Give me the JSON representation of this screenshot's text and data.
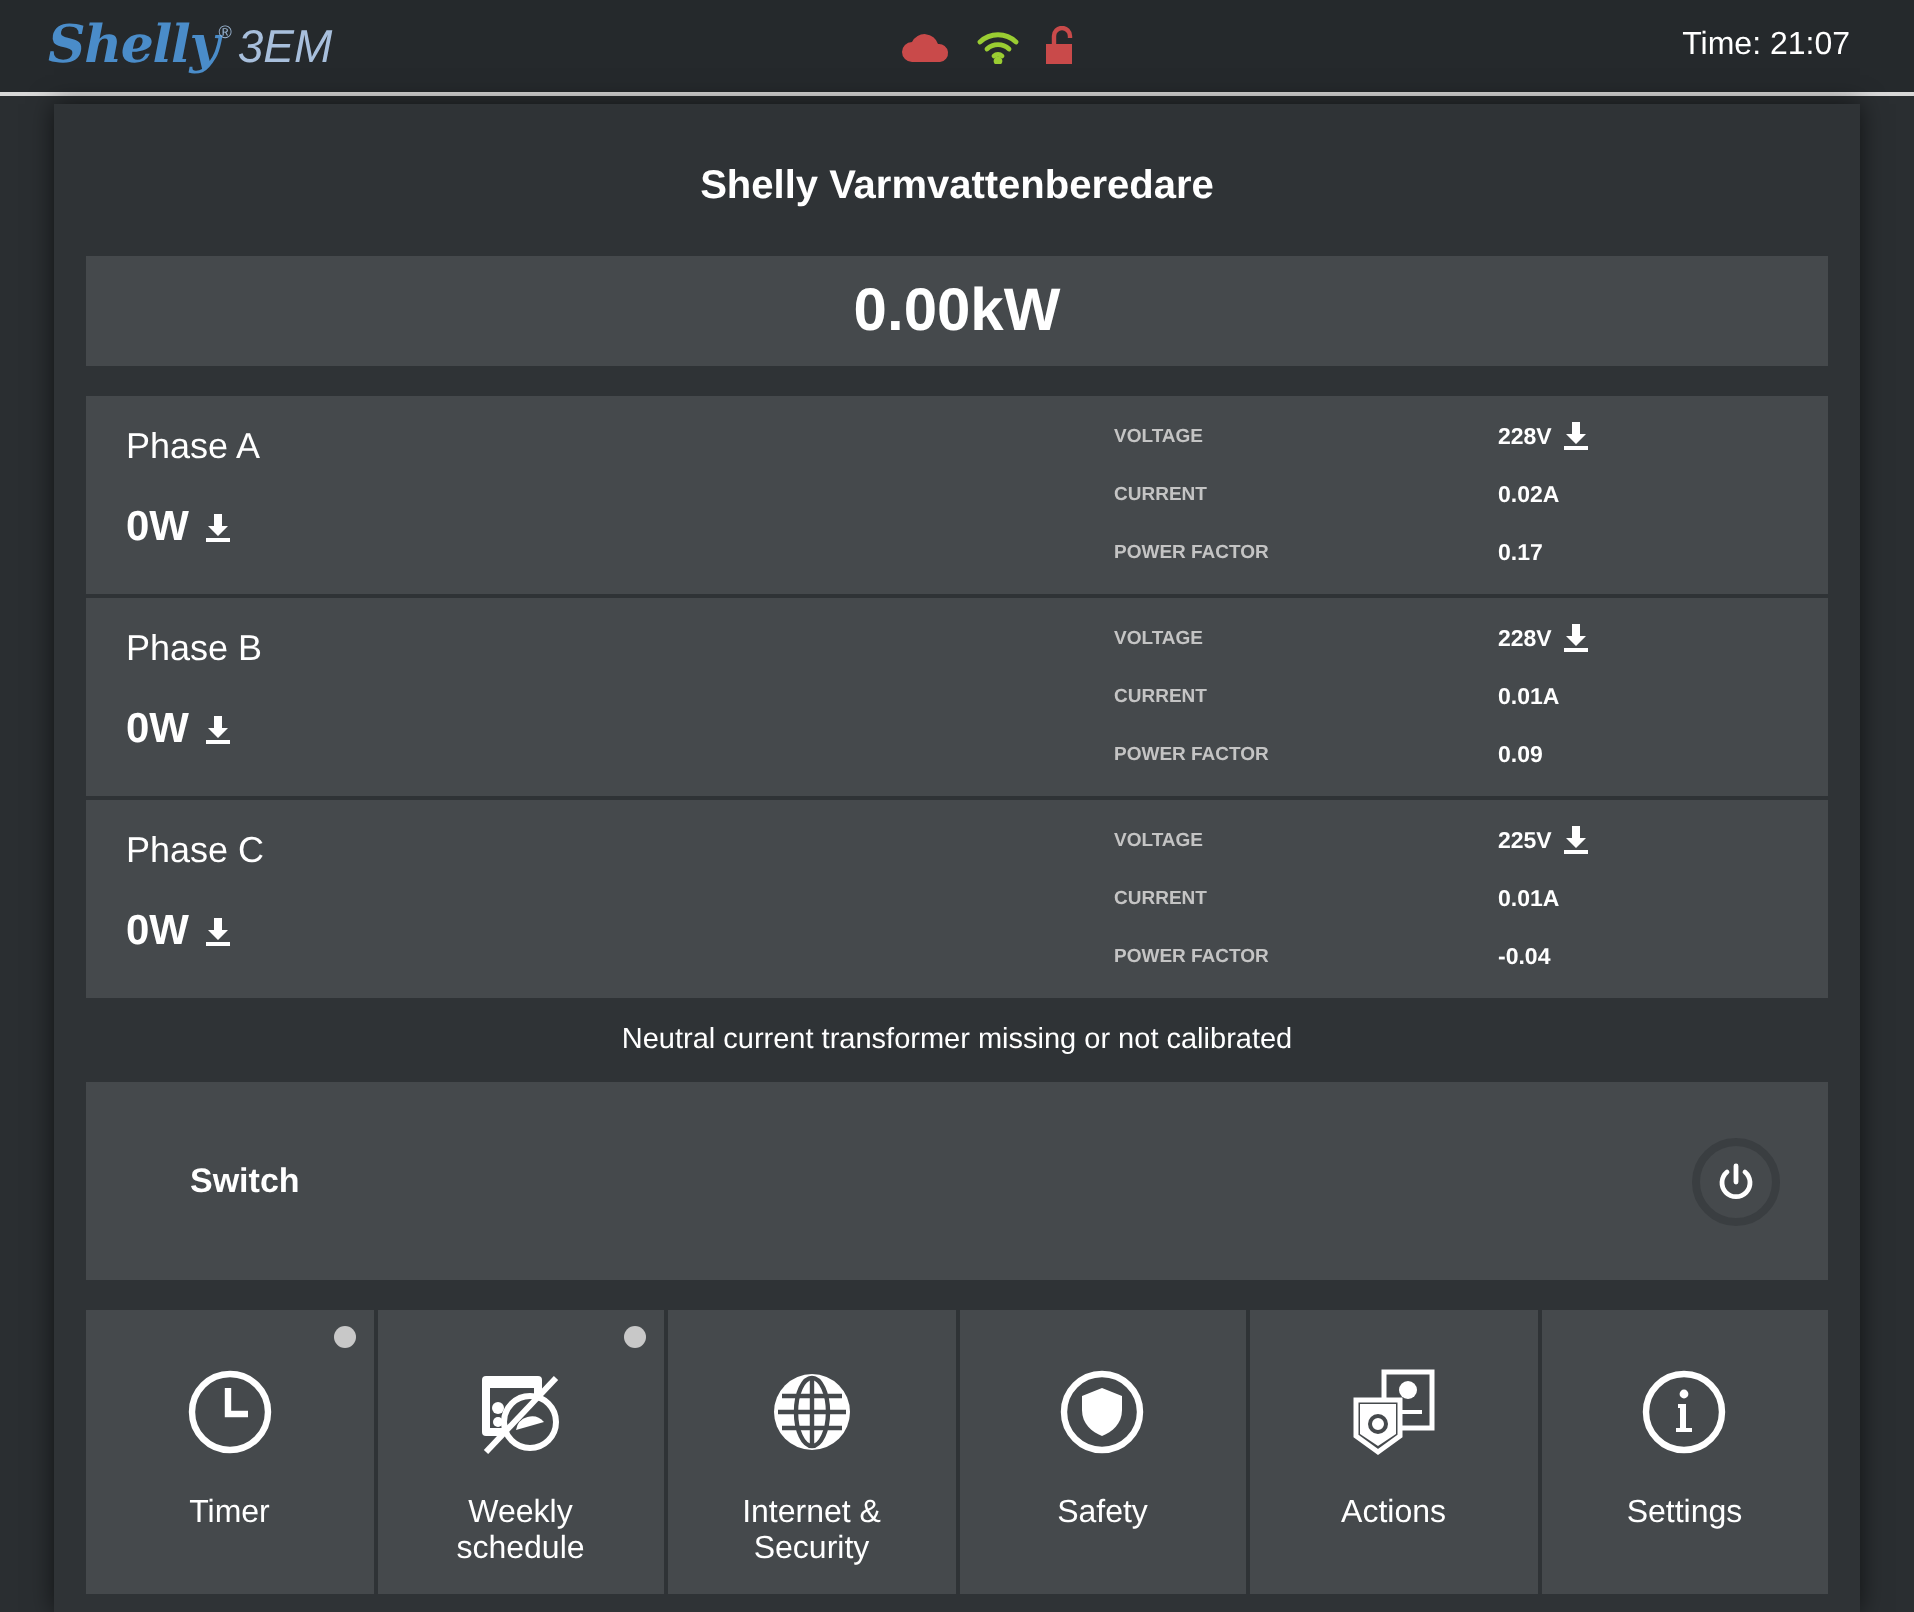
{
  "header": {
    "brand": "Shelly",
    "registered": "®",
    "model": "3EM",
    "status_icons": [
      {
        "kind": "cloud",
        "color": "#c94a4a"
      },
      {
        "kind": "wifi",
        "color": "#9acd32"
      },
      {
        "kind": "lock",
        "color": "#c94a4a"
      }
    ],
    "time": "Time: 21:07"
  },
  "device": {
    "title": "Shelly Varmvattenberedare",
    "total_power": "0.00kW"
  },
  "phases": [
    {
      "name": "Phase A",
      "power": "0W",
      "power_arrow": true,
      "readings": [
        {
          "label": "VOLTAGE",
          "value": "228V",
          "arrow": true
        },
        {
          "label": "CURRENT",
          "value": "0.02A",
          "arrow": false
        },
        {
          "label": "POWER FACTOR",
          "value": "0.17",
          "arrow": false
        }
      ]
    },
    {
      "name": "Phase B",
      "power": "0W",
      "power_arrow": true,
      "readings": [
        {
          "label": "VOLTAGE",
          "value": "228V",
          "arrow": true
        },
        {
          "label": "CURRENT",
          "value": "0.01A",
          "arrow": false
        },
        {
          "label": "POWER FACTOR",
          "value": "0.09",
          "arrow": false
        }
      ]
    },
    {
      "name": "Phase C",
      "power": "0W",
      "power_arrow": true,
      "readings": [
        {
          "label": "VOLTAGE",
          "value": "225V",
          "arrow": true
        },
        {
          "label": "CURRENT",
          "value": "0.01A",
          "arrow": false
        },
        {
          "label": "POWER FACTOR",
          "value": "-0.04",
          "arrow": false
        }
      ]
    }
  ],
  "notice": "Neutral current transformer missing or not calibrated",
  "switch": {
    "label": "Switch",
    "on": false
  },
  "tiles": [
    {
      "kind": "timer",
      "label": "Timer",
      "indicator": true
    },
    {
      "kind": "schedule",
      "label": "Weekly schedule",
      "indicator": true
    },
    {
      "kind": "internet",
      "label": "Internet & Security",
      "indicator": false
    },
    {
      "kind": "safety",
      "label": "Safety",
      "indicator": false
    },
    {
      "kind": "actions",
      "label": "Actions",
      "indicator": false
    },
    {
      "kind": "settings",
      "label": "Settings",
      "indicator": false
    }
  ]
}
